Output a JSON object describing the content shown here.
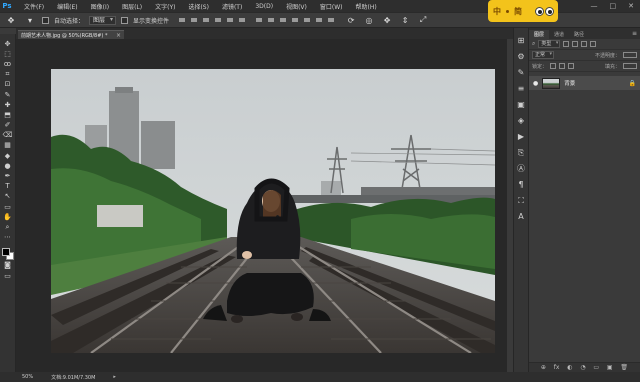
{
  "menu": {
    "logo": "Ps",
    "items": [
      "文件(F)",
      "编辑(E)",
      "图像(I)",
      "图层(L)",
      "文字(Y)",
      "选择(S)",
      "滤镜(T)",
      "3D(D)",
      "视图(V)",
      "窗口(W)",
      "帮助(H)"
    ]
  },
  "window_controls": [
    "—",
    "□",
    "✕"
  ],
  "options": {
    "tool_icon": "move-tool-icon",
    "auto_select_label": "自动选择：",
    "auto_select_value": "图层",
    "show_transform_label": "显示变换控件"
  },
  "badge": {
    "chars": [
      "中",
      "简"
    ]
  },
  "doc_tab": {
    "title": "前期艺术人物.jpg @ 50%(RGB/8#) *",
    "close": "×"
  },
  "tools": [
    "✥",
    "⬚",
    "ꝏ",
    "⌗",
    "⊡",
    "✎",
    "✚",
    "⬒",
    "✐",
    "⌫",
    "▦",
    "◆",
    "●",
    "✒",
    "T",
    "↖",
    "▭",
    "✋",
    "⌕",
    "⋯"
  ],
  "strip_icons": [
    "⊞",
    "⚙",
    "✎",
    "≡",
    "▣",
    "◈",
    "▶",
    "⎘",
    "Ⓐ",
    "¶",
    "⛶",
    "A"
  ],
  "layers_panel": {
    "tabs": [
      "图层",
      "通道",
      "路径"
    ],
    "kind_label": "类型",
    "blend_mode": "正常",
    "opacity_label": "不透明度：",
    "lock_label": "锁定：",
    "fill_label": "填充：",
    "layer": {
      "name": "背景"
    },
    "bottom_icons": [
      "⊕",
      "fx",
      "◐",
      "◔",
      "▭",
      "▣",
      "🗑"
    ]
  },
  "status": {
    "zoom": "50%",
    "doc_info": "文档:9.01M/7.30M"
  },
  "colors": {
    "accent": "#31a8ff",
    "badge": "#f3c31b",
    "fg_swatch": "#000000",
    "bg_swatch": "#ffffff"
  }
}
